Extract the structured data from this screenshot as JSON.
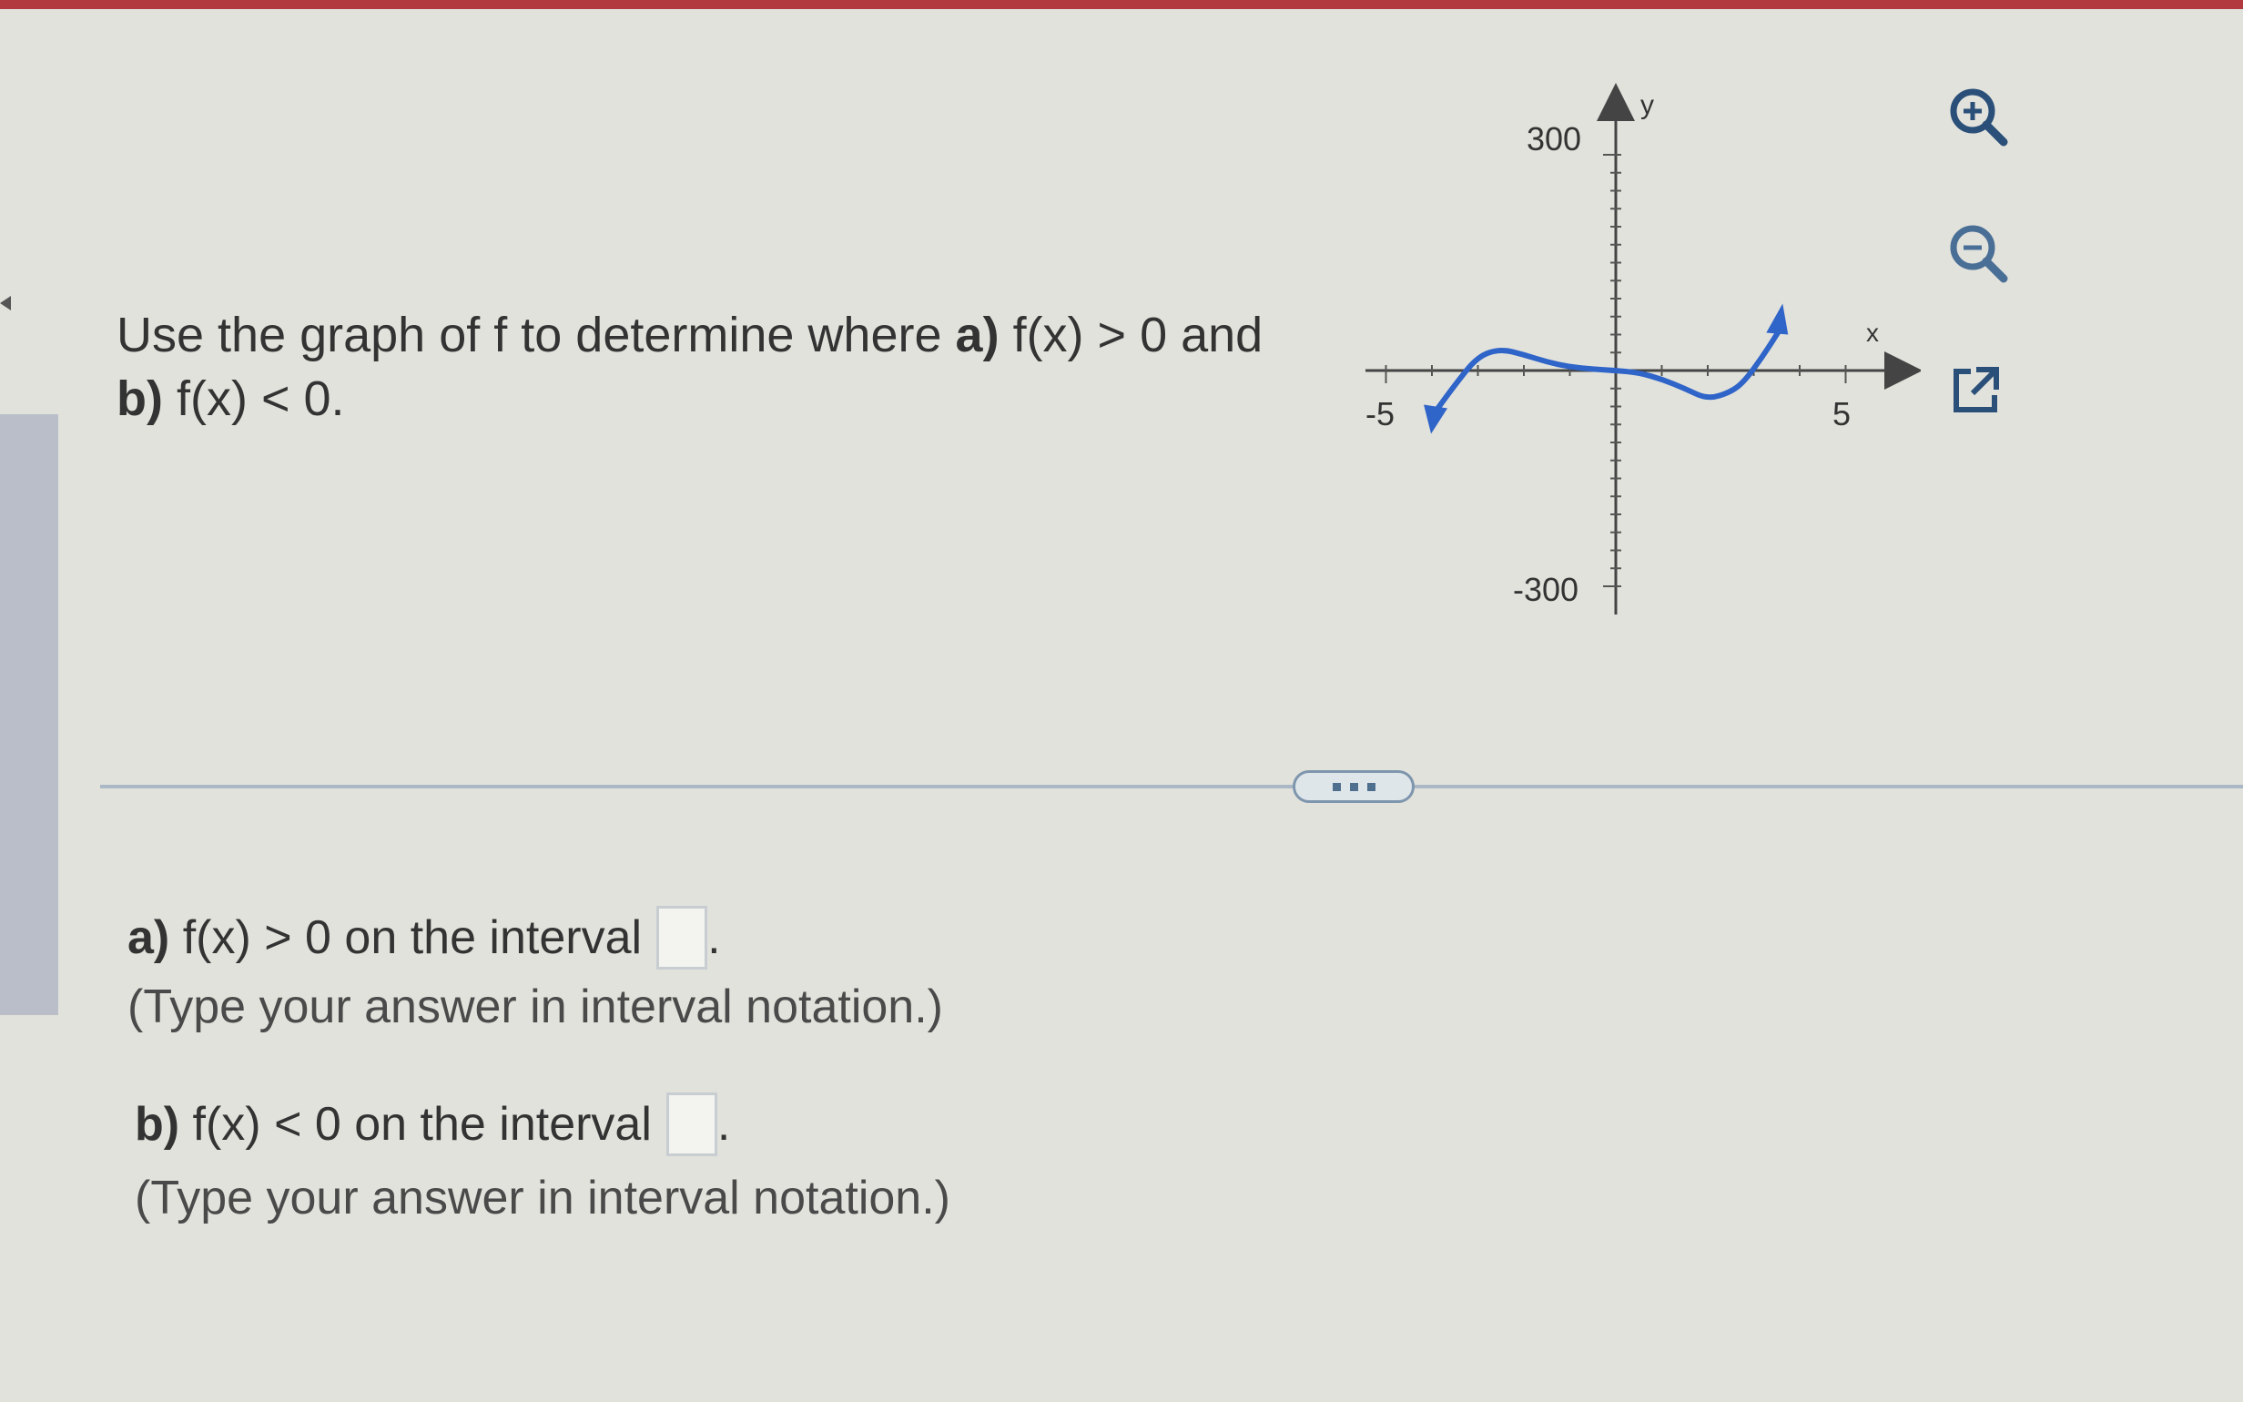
{
  "question": {
    "prefix": "Use the graph of f to determine where",
    "part_a_label": "a)",
    "part_a_expr": "f(x) > 0 and",
    "part_b_label": "b)",
    "part_b_expr": "f(x) < 0."
  },
  "graph": {
    "y_axis_label": "y",
    "x_axis_label": "x",
    "y_max_label": "300",
    "y_min_label": "-300",
    "x_min_label": "-5",
    "x_max_label": "5",
    "curve_color": "#2f64c8"
  },
  "chart_data": {
    "type": "line",
    "x_label": "x",
    "y_label": "y",
    "xlim": [
      -6,
      6
    ],
    "ylim": [
      -380,
      380
    ],
    "x_ticks": [
      -5,
      5
    ],
    "y_ticks": [
      300,
      -300
    ],
    "series": [
      {
        "x": [
          -3.9,
          -3.5,
          -3.0,
          -2.5,
          -2.0,
          -1.5,
          -1.0,
          -0.5,
          0.0,
          0.5,
          1.0,
          1.5,
          2.0,
          2.5,
          2.8,
          3.2,
          3.55
        ],
        "y": [
          -55,
          -20,
          20,
          30,
          22,
          12,
          5,
          2,
          0,
          -3,
          -12,
          -25,
          -40,
          -30,
          -15,
          20,
          55
        ]
      }
    ]
  },
  "tools": {
    "zoom_in": "zoom-in-icon",
    "zoom_out": "zoom-out-icon",
    "popout": "external-link-icon"
  },
  "answers": {
    "a_label": "a)",
    "a_text": "f(x) > 0 on the interval",
    "a_hint": "(Type your answer in interval notation.)",
    "b_label": "b)",
    "b_text": "f(x) < 0 on the interval",
    "b_hint": "(Type your answer in interval notation.)",
    "suffix": "."
  }
}
